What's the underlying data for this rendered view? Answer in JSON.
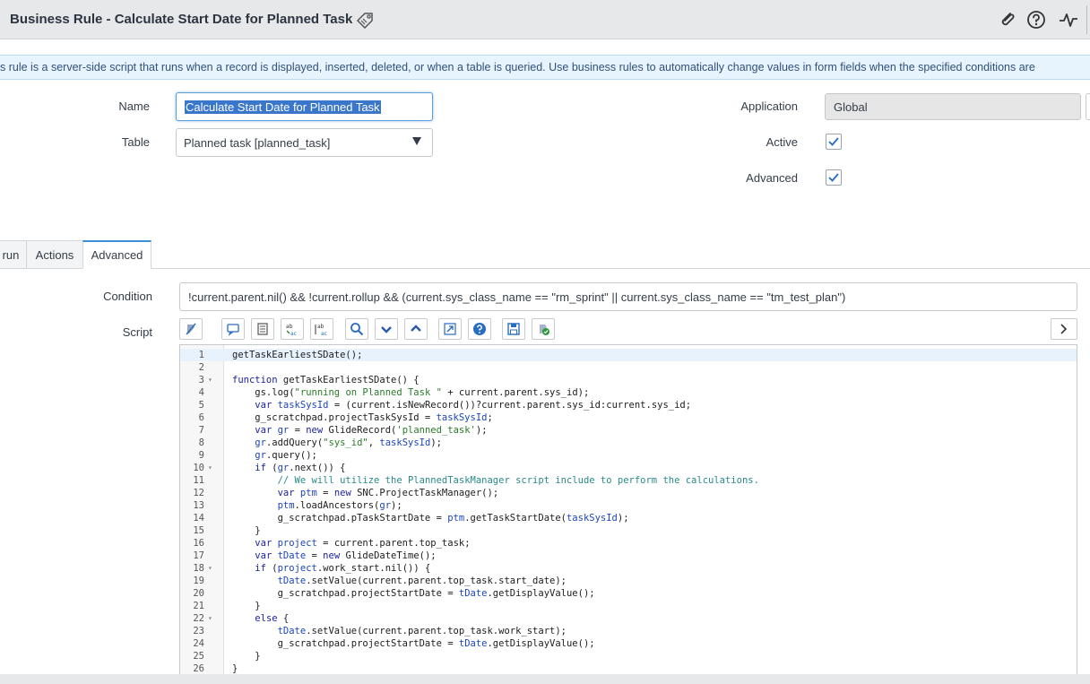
{
  "header": {
    "title": "Business Rule - Calculate Start Date for Planned Task",
    "icons": [
      "tag-icon",
      "paperclip-icon",
      "help-icon",
      "activity-icon"
    ]
  },
  "info_banner": "s rule is a server-side script that runs when a record is displayed, inserted, deleted, or when a table is queried. Use business rules to automatically change values in form fields when the specified conditions are",
  "form": {
    "name_label": "Name",
    "name_value": "Calculate Start Date for Planned Task",
    "table_label": "Table",
    "table_value": "Planned task [planned_task]",
    "application_label": "Application",
    "application_value": "Global",
    "active_label": "Active",
    "active_checked": true,
    "advanced_label": "Advanced",
    "advanced_checked": true
  },
  "tabs": [
    {
      "label": "run",
      "active": false
    },
    {
      "label": "Actions",
      "active": false
    },
    {
      "label": "Advanced",
      "active": true
    }
  ],
  "advanced": {
    "condition_label": "Condition",
    "condition_value": "!current.parent.nil() && !current.rollup && (current.sys_class_name == \"rm_sprint\" || current.sys_class_name == \"tm_test_plan\")",
    "script_label": "Script",
    "toolbar": [
      "format-icon",
      "comment-icon",
      "uncomment-icon",
      "replace-icon",
      "replace-all-icon",
      "search-icon",
      "next-icon",
      "previous-icon",
      "fullscreen-icon",
      "help-icon",
      "save-icon",
      "check-icon"
    ],
    "expand_icon": "chevron-right-icon"
  },
  "script_lines": [
    "getTaskEarliestSDate();",
    "",
    "function getTaskEarliestSDate() {",
    "    gs.log(\"running on Planned Task \" + current.parent.sys_id);",
    "    var taskSysId = (current.isNewRecord())?current.parent.sys_id:current.sys_id;",
    "    g_scratchpad.projectTaskSysId = taskSysId;",
    "    var gr = new GlideRecord('planned_task');",
    "    gr.addQuery(\"sys_id\", taskSysId);",
    "    gr.query();",
    "    if (gr.next()) {",
    "        // We will utilize the PlannedTaskManager script include to perform the calculations.",
    "        var ptm = new SNC.ProjectTaskManager();",
    "        ptm.loadAncestors(gr);",
    "        g_scratchpad.pTaskStartDate = ptm.getTaskStartDate(taskSysId);",
    "    }",
    "    var project = current.parent.top_task;",
    "    var tDate = new GlideDateTime();",
    "    if (project.work_start.nil()) {",
    "        tDate.setValue(current.parent.top_task.start_date);",
    "        g_scratchpad.projectStartDate = tDate.getDisplayValue();",
    "    }",
    "    else {",
    "        tDate.setValue(current.parent.top_task.work_start);",
    "        g_scratchpad.projectStartDate = tDate.getDisplayValue();",
    "    }",
    "}"
  ],
  "fold_lines": [
    3,
    10,
    18,
    22
  ]
}
